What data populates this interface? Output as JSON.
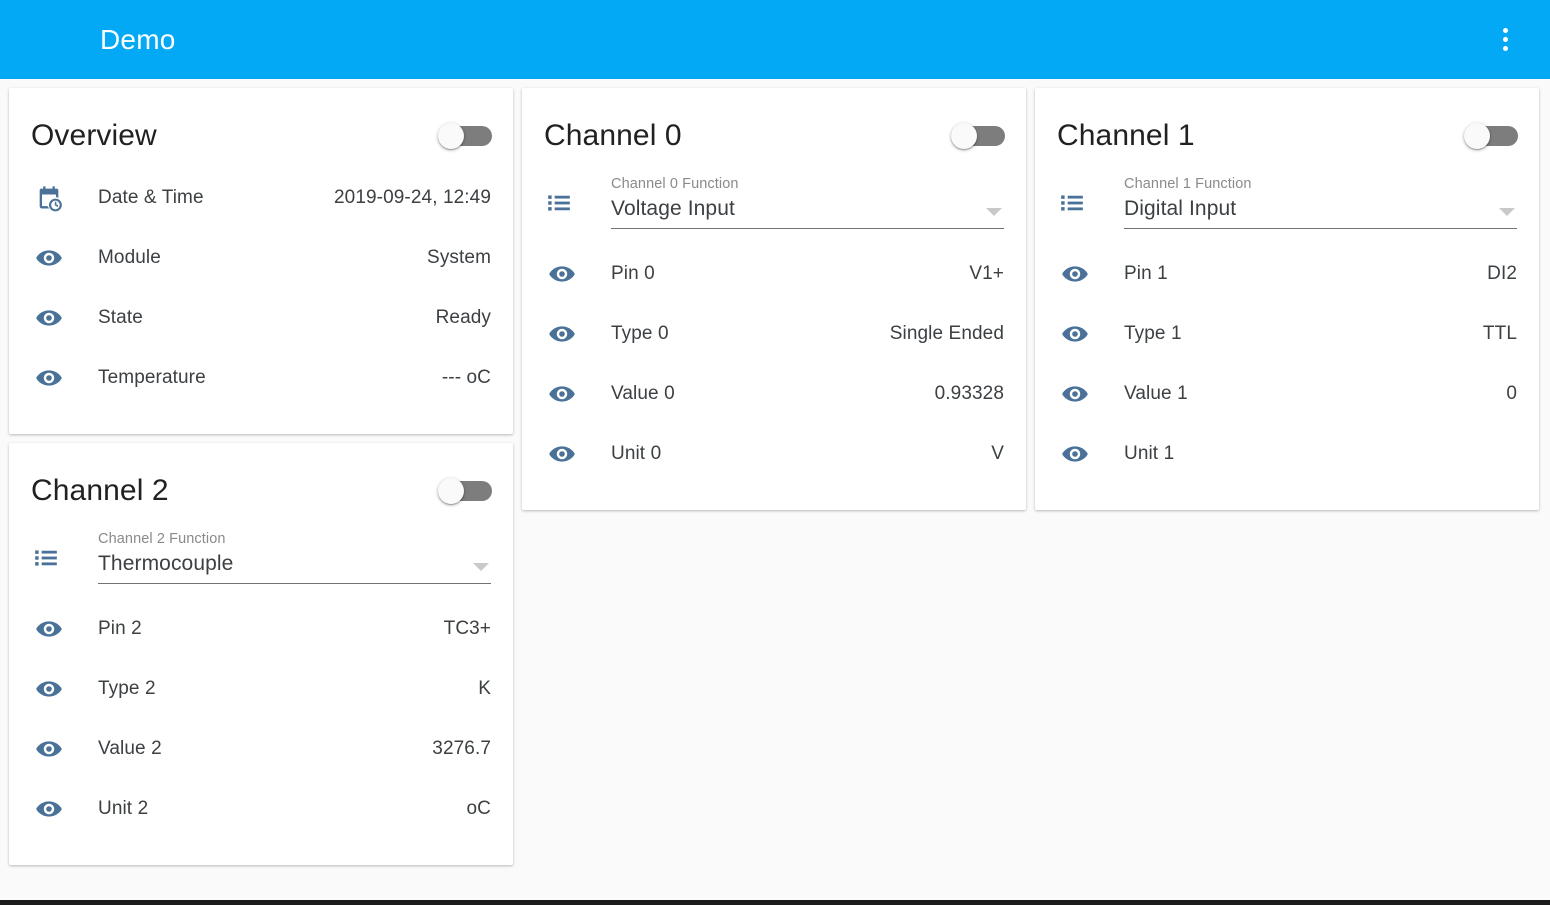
{
  "appbar": {
    "title": "Demo",
    "overflow_icon": "more-vert-icon"
  },
  "cards": {
    "overview": {
      "title": "Overview",
      "toggle_state": "off",
      "rows": [
        {
          "icon": "calendar-clock-icon",
          "label": "Date & Time",
          "value": "2019-09-24, 12:49"
        },
        {
          "icon": "eye-icon",
          "label": "Module",
          "value": "System"
        },
        {
          "icon": "eye-icon",
          "label": "State",
          "value": "Ready"
        },
        {
          "icon": "eye-icon",
          "label": "Temperature",
          "value": "--- oC"
        }
      ]
    },
    "channel0": {
      "title": "Channel 0",
      "toggle_state": "off",
      "select": {
        "icon": "list-icon",
        "caption": "Channel 0 Function",
        "value": "Voltage Input"
      },
      "rows": [
        {
          "icon": "eye-icon",
          "label": "Pin 0",
          "value": "V1+"
        },
        {
          "icon": "eye-icon",
          "label": "Type 0",
          "value": "Single Ended"
        },
        {
          "icon": "eye-icon",
          "label": "Value 0",
          "value": "0.93328"
        },
        {
          "icon": "eye-icon",
          "label": "Unit 0",
          "value": "V"
        }
      ]
    },
    "channel1": {
      "title": "Channel 1",
      "toggle_state": "off",
      "select": {
        "icon": "list-icon",
        "caption": "Channel 1 Function",
        "value": "Digital Input"
      },
      "rows": [
        {
          "icon": "eye-icon",
          "label": "Pin 1",
          "value": "DI2"
        },
        {
          "icon": "eye-icon",
          "label": "Type 1",
          "value": "TTL"
        },
        {
          "icon": "eye-icon",
          "label": "Value 1",
          "value": "0"
        },
        {
          "icon": "eye-icon",
          "label": "Unit 1",
          "value": ""
        }
      ]
    },
    "channel2": {
      "title": "Channel 2",
      "toggle_state": "off",
      "select": {
        "icon": "list-icon",
        "caption": "Channel 2 Function",
        "value": "Thermocouple"
      },
      "rows": [
        {
          "icon": "eye-icon",
          "label": "Pin 2",
          "value": "TC3+"
        },
        {
          "icon": "eye-icon",
          "label": "Type 2",
          "value": "K"
        },
        {
          "icon": "eye-icon",
          "label": "Value 2",
          "value": "3276.7"
        },
        {
          "icon": "eye-icon",
          "label": "Unit 2",
          "value": "oC"
        }
      ]
    }
  },
  "colors": {
    "appbar": "#03a9f4",
    "icon_blue": "#4a7299",
    "page_background": "#fafafa",
    "card_background": "#ffffff",
    "toggle_track": "#7d7d7d"
  }
}
